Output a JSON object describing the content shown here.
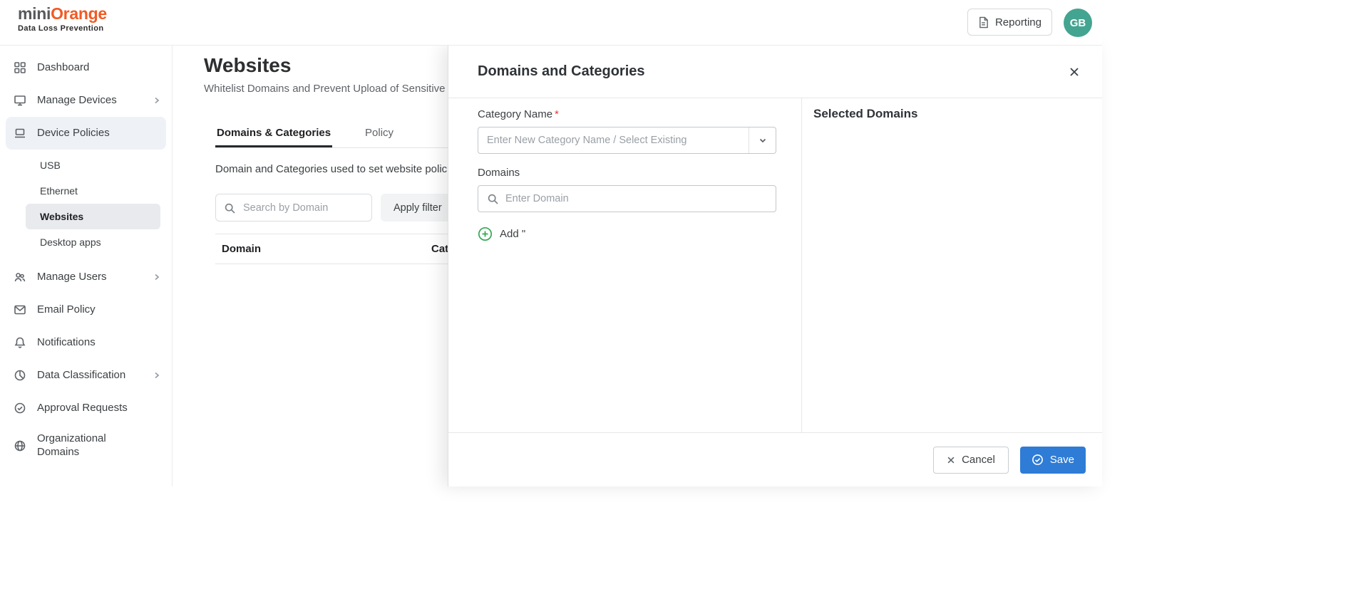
{
  "colors": {
    "brand_orange": "#f15a24",
    "primary_blue": "#2e7cd6",
    "success_green": "#34a853",
    "danger_red": "#e53935",
    "avatar_teal": "#43a491"
  },
  "header": {
    "brand_mini": "mini",
    "brand_orange": "Orange",
    "tagline": "Data Loss Prevention",
    "reporting_label": "Reporting",
    "avatar_initials": "GB"
  },
  "sidebar": {
    "items": [
      {
        "label": "Dashboard",
        "icon": "dashboard-icon"
      },
      {
        "label": "Manage Devices",
        "icon": "monitor-icon",
        "chevron": true
      },
      {
        "label": "Device Policies",
        "icon": "laptop-icon",
        "active": true
      },
      {
        "label": "Manage Users",
        "icon": "users-icon",
        "chevron": true
      },
      {
        "label": "Email Policy",
        "icon": "envelope-icon"
      },
      {
        "label": "Notifications",
        "icon": "bell-icon"
      },
      {
        "label": "Data Classification",
        "icon": "pie-chart-icon",
        "chevron": true
      },
      {
        "label": "Approval Requests",
        "icon": "check-badge-icon"
      },
      {
        "label": "Organizational Domains",
        "icon": "globe-icon"
      }
    ],
    "device_policies_children": [
      {
        "label": "USB"
      },
      {
        "label": "Ethernet"
      },
      {
        "label": "Websites",
        "selected": true
      },
      {
        "label": "Desktop apps"
      }
    ]
  },
  "main": {
    "title": "Websites",
    "subtitle": "Whitelist Domains and Prevent Upload of Sensitive Data",
    "tabs": [
      {
        "label": "Domains & Categories",
        "active": true
      },
      {
        "label": "Policy",
        "active": false
      }
    ],
    "description": "Domain and Categories used to set website policies",
    "search_placeholder": "Search by Domain",
    "apply_filter_label": "Apply filter",
    "table_columns": [
      "Domain",
      "Categories"
    ]
  },
  "drawer": {
    "title": "Domains and Categories",
    "category_label": "Category Name",
    "required_marker": "*",
    "category_placeholder": "Enter New Category Name / Select Existing",
    "domains_label": "Domains",
    "domain_placeholder": "Enter Domain",
    "add_label": "Add \"",
    "selected_domains_title": "Selected Domains",
    "cancel_label": "Cancel",
    "save_label": "Save"
  }
}
